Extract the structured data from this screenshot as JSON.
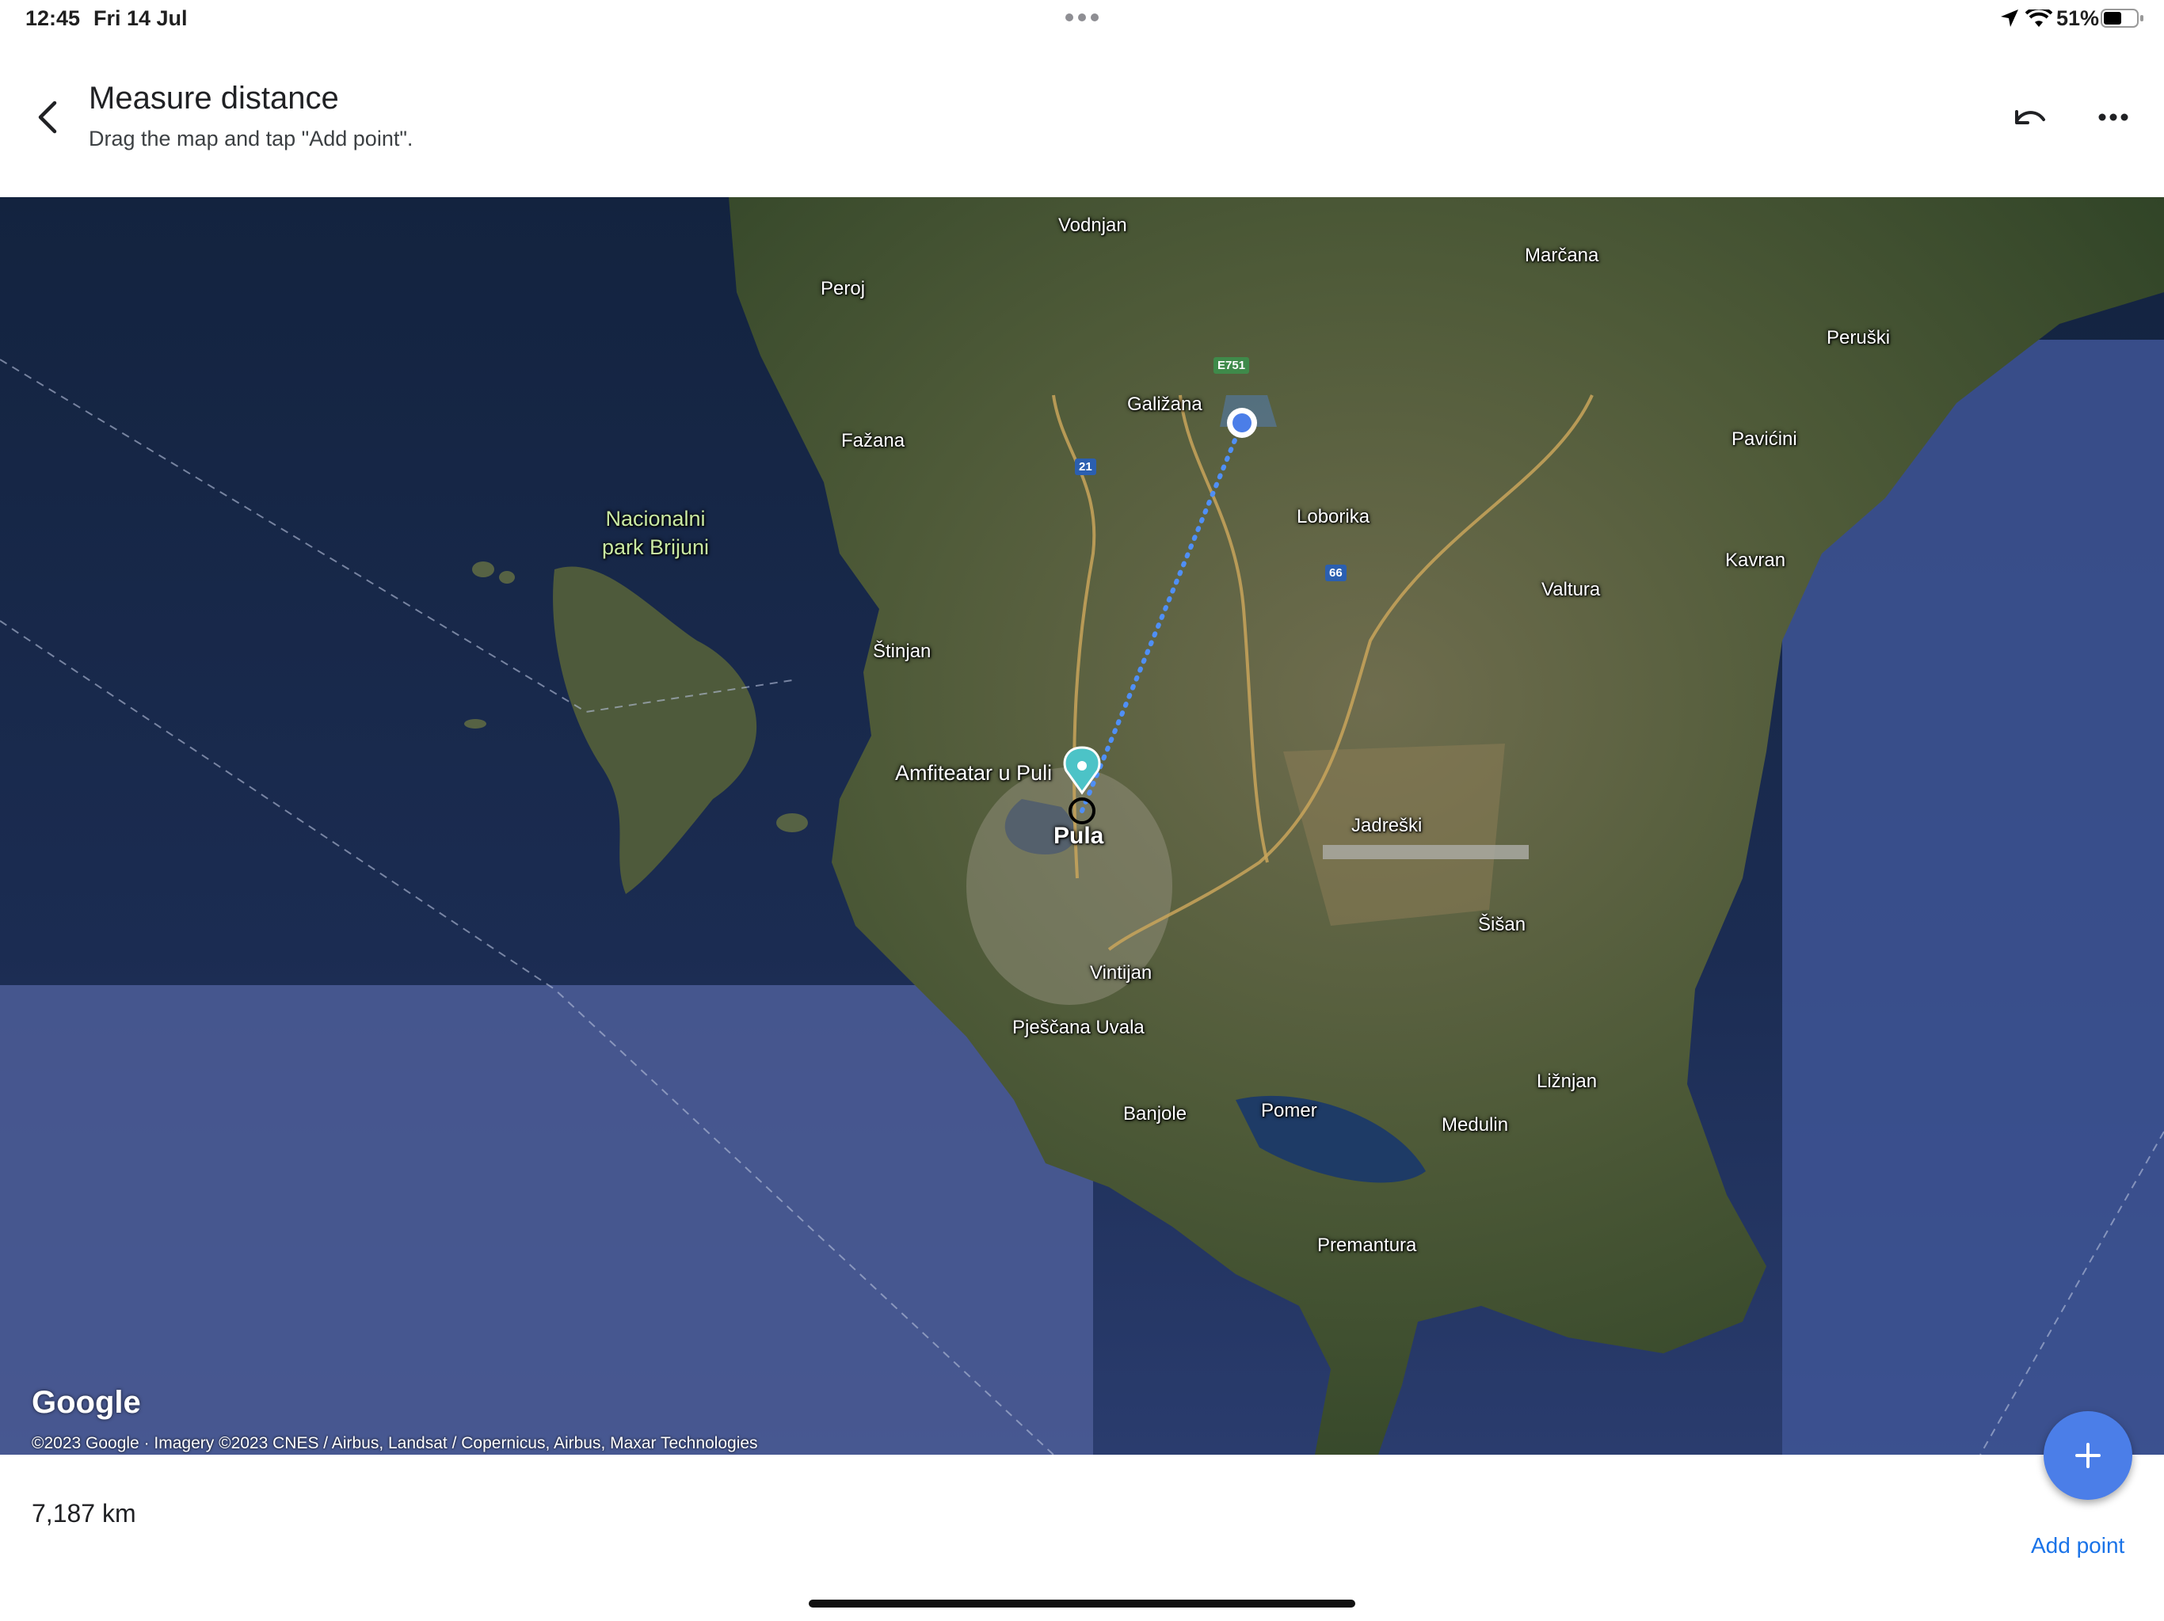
{
  "status_bar": {
    "time": "12:45",
    "date": "Fri 14 Jul",
    "battery": "51%"
  },
  "header": {
    "title": "Measure distance",
    "subtitle": "Drag the map and tap \"Add point\"."
  },
  "map": {
    "places": {
      "vodnjan": "Vodnjan",
      "marcana": "Marčana",
      "peroj": "Peroj",
      "peruski": "Peruški",
      "galizana": "Galižana",
      "fazana": "Fažana",
      "pavicini": "Pavićini",
      "loborika": "Loborika",
      "kavran": "Kavran",
      "valtura": "Valtura",
      "stinjan": "Štinjan",
      "amfiteatar": "Amfiteatar u Puli",
      "pula": "Pula",
      "jadreski": "Jadreški",
      "sisan": "Šišan",
      "vintijan": "Vintijan",
      "pjescana_uvala": "Pješčana Uvala",
      "liznjan": "Ližnjan",
      "banjole": "Banjole",
      "pomer": "Pomer",
      "medulin": "Medulin",
      "premantura": "Premantura"
    },
    "park_label_line1": "Nacionalni",
    "park_label_line2": "park Brijuni",
    "road_shields": {
      "e751": "E751",
      "r21": "21",
      "r66": "66"
    },
    "logo": "Google",
    "attribution": "©2023 Google · Imagery ©2023 CNES / Airbus, Landsat / Copernicus, Airbus, Maxar Technologies"
  },
  "bottom_panel": {
    "distance": "7,187 km",
    "add_point_label": "Add point"
  },
  "colors": {
    "accent": "#1a73e8",
    "fab": "#4b7ee8",
    "measure_line": "#4f8ff7"
  }
}
